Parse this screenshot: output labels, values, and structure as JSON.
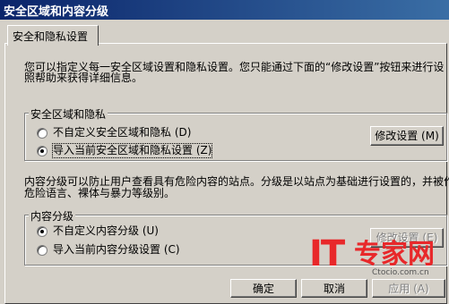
{
  "window": {
    "title": "安全区域和内容分级"
  },
  "tab": {
    "label": "安全和隐私设置"
  },
  "intro": {
    "line1": "您可以指定义每一安全区域设置和隐私设置。您只能通过下面的“修改设置”按钮来进行设",
    "line2": "照帮助来获得详细信息。"
  },
  "security_group": {
    "title": "安全区域和隐私",
    "option_custom": "不自定义安全区域和隐私 (D)",
    "option_import": "导入当前安全区域和隐私设置 (Z)",
    "selected": "import",
    "modify_button": "修改设置 (M)"
  },
  "ratings_desc": {
    "line1": "内容分级可以防止用户查看具有危险内容的站点。分级是以站点为基础进行设置的，并被作",
    "line2": "危险语言、裸体与暴力等级别。"
  },
  "ratings_group": {
    "title": "内容分级",
    "option_custom": "不自定义内容分级 (U)",
    "option_import": "导入当前内容分级设置 (C)",
    "selected": "custom",
    "modify_button": "修改设置 (E)"
  },
  "footer": {
    "ok": "确定",
    "cancel": "取消",
    "apply": "应用 (A)"
  },
  "watermark": {
    "brand": "IT",
    "brand_cn": "专家网",
    "domain": "Ctocio.com.cn",
    "color": "#e8282a"
  }
}
